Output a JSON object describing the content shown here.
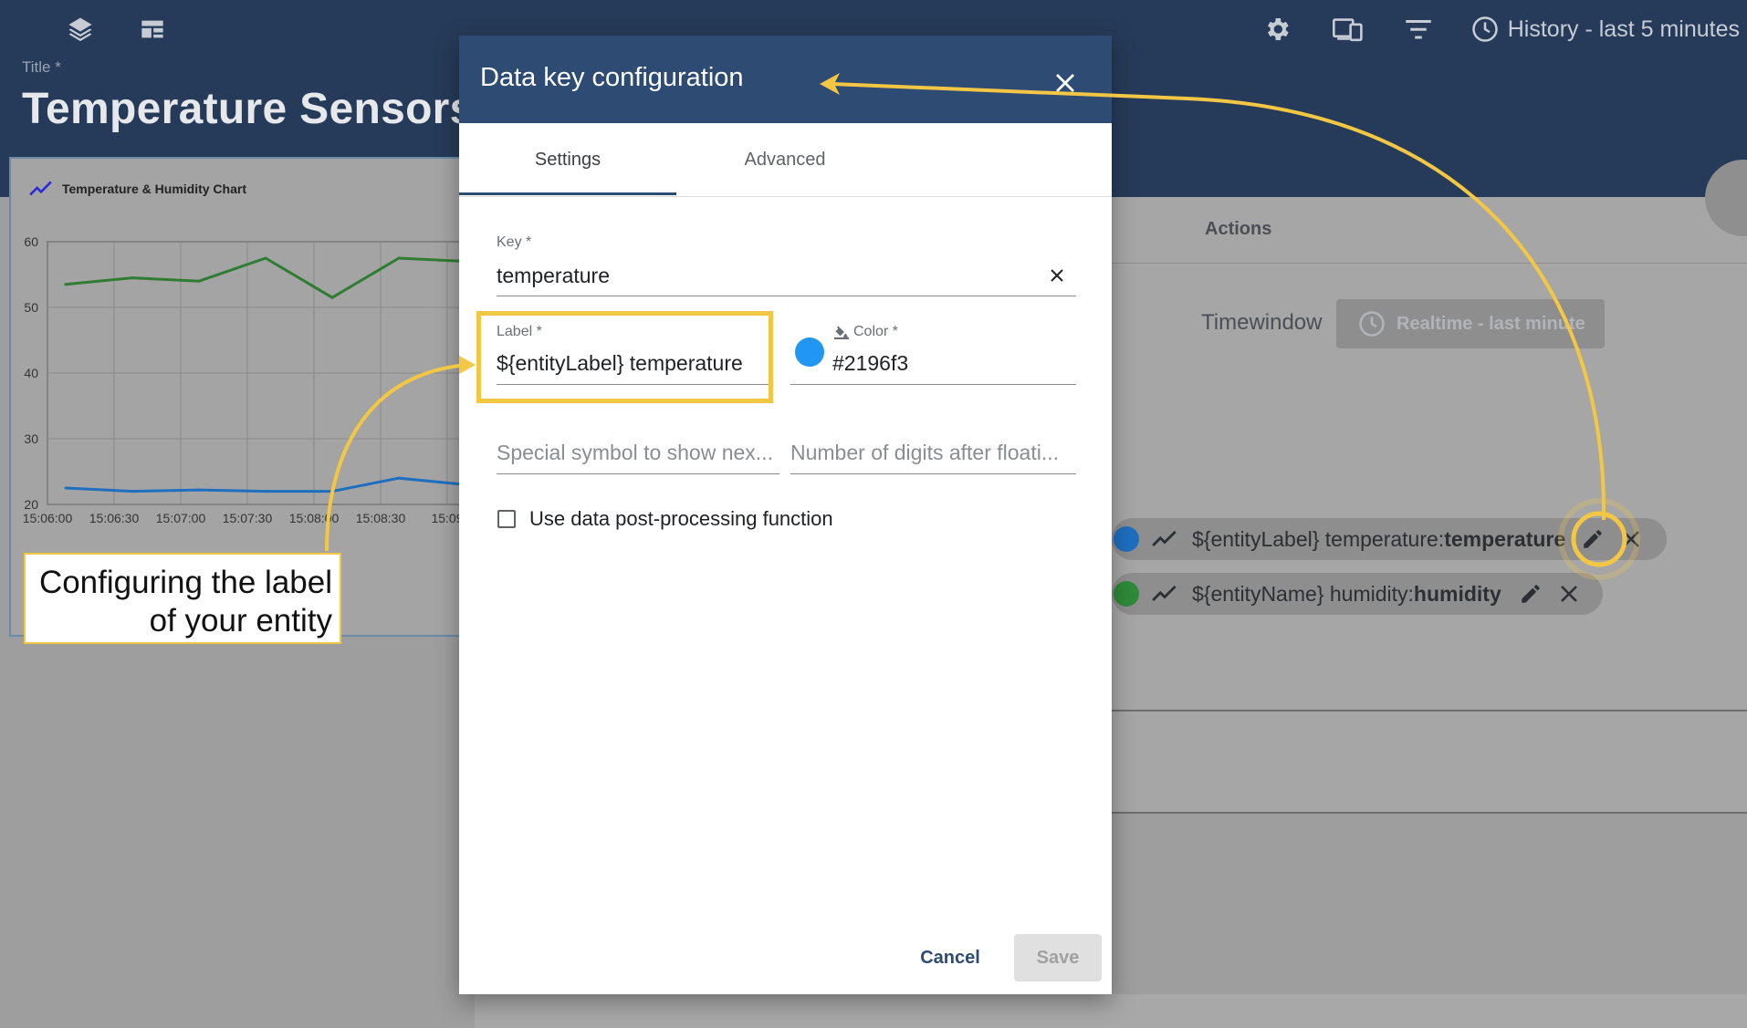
{
  "topbar": {
    "history_label": "History - last 5 minutes"
  },
  "page": {
    "title_label": "Title *",
    "title_value": "Temperature Sensors"
  },
  "chart": {
    "title": "Temperature & Humidity Chart"
  },
  "chart_data": {
    "type": "line",
    "title": "Temperature & Humidity Chart",
    "x": [
      "15:06:00",
      "15:06:30",
      "15:07:00",
      "15:07:30",
      "15:08:00",
      "15:08:30",
      "15:09"
    ],
    "x_ticks": [
      "15:06:00",
      "15:06:30",
      "15:07:00",
      "15:07:30",
      "15:08:00",
      "15:08:30",
      "15:09"
    ],
    "y_ticks": [
      "60",
      "50",
      "40",
      "30",
      "20"
    ],
    "ylim": [
      20,
      60
    ],
    "grid": true,
    "series": [
      {
        "color": "#2e7d32",
        "values": [
          53.5,
          54.5,
          54,
          57.5,
          51.5,
          57.5,
          57
        ]
      },
      {
        "color": "#1e6fc0",
        "values": [
          22.5,
          22,
          22.2,
          22,
          22,
          24,
          23
        ]
      }
    ]
  },
  "right": {
    "actions_label": "Actions",
    "timewindow_label": "Timewindow",
    "timewindow_button": "Realtime - last minute",
    "chips": [
      {
        "color": "#1e6fc0",
        "title": "${entityLabel} temperature: ",
        "key": "temperature"
      },
      {
        "color": "#2e8b3a",
        "title": "${entityName} humidity: ",
        "key": "humidity"
      }
    ]
  },
  "dialog": {
    "title": "Data key configuration",
    "tabs": [
      "Settings",
      "Advanced"
    ],
    "key_label": "Key *",
    "key_value": "temperature",
    "label_label": "Label *",
    "label_value": "${entityLabel} temperature",
    "color_label": "Color *",
    "color_value": "#2196f3",
    "color_hex": "#2196f3",
    "special_symbol_placeholder": "Special symbol to show nex...",
    "digits_placeholder": "Number of digits after floati...",
    "postprocess_label": "Use data post-processing function",
    "cancel_label": "Cancel",
    "save_label": "Save"
  },
  "callout": {
    "line1": "Configuring the label",
    "line2": "of your entity"
  },
  "colors": {
    "topbar": "#263b59",
    "dialog_header": "#2d4b73",
    "highlight": "#f3c744"
  }
}
